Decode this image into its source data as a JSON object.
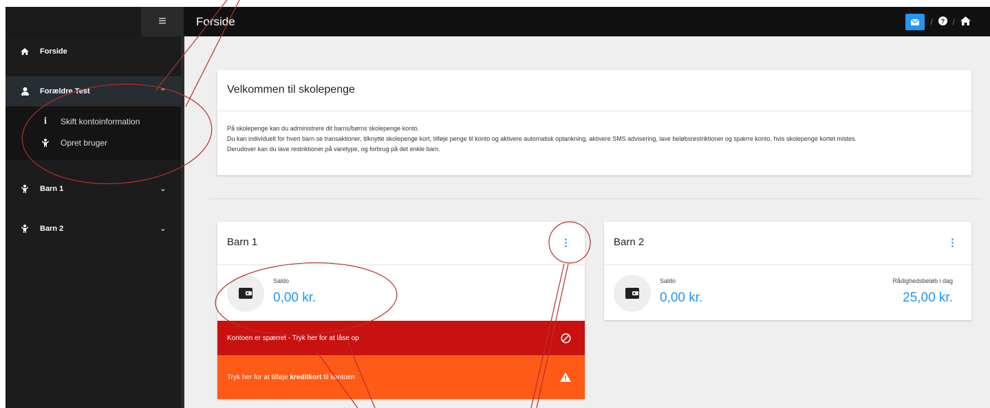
{
  "topbar": {
    "title": "Forside",
    "menu_icon": "hamburger-icon",
    "icons": [
      "envelope-icon",
      "question-circle-icon",
      "home-icon"
    ],
    "separator": "/"
  },
  "sidebar": {
    "items": [
      {
        "label": "Forside",
        "icon": "home-icon"
      },
      {
        "label": "Forældre Test",
        "icon": "user-icon"
      },
      {
        "label": "Barn 1",
        "icon": "child-icon"
      },
      {
        "label": "Barn 2",
        "icon": "child-icon"
      }
    ],
    "submenu": [
      {
        "label": "Skift kontoinformation",
        "icon": "info-icon"
      },
      {
        "label": "Opret bruger",
        "icon": "child-icon"
      }
    ]
  },
  "welcome": {
    "title": "Velkommen til skolepenge",
    "paragraphs": [
      "På skolepenge kan du administrere dit barns/børns skolepenge konto.",
      "Du kan individuelt for hvert barn se transaktioner, tilknytte skolepenge kort, tilføje penge til konto og aktivere automatisk optankning, aktivere SMS advisering, lave beløbsrestriktioner og spærre konto, hvis skolepenge kortet mistes.",
      "Derudover kan du lave restriktioner på varetype, og forbrug på det enkle barn."
    ]
  },
  "children": [
    {
      "name": "Barn 1",
      "saldo_label": "Saldo",
      "saldo_value": "0,00 kr.",
      "blocked_banner": "Kontoen er spærret - Tryk her for at låse op",
      "card_banner_prefix": "Tryk her for at tilføje ",
      "card_banner_bold": "kreditkort",
      "card_banner_suffix": " til kontoen"
    },
    {
      "name": "Barn 2",
      "saldo_label": "Saldo",
      "saldo_value": "0,00 kr.",
      "available_label": "Rådighedsbeløb i dag",
      "available_value": "25,00 kr."
    }
  ],
  "colors": {
    "accent": "#2196f3",
    "danger": "#c9120f",
    "warning": "#ff5a16",
    "annotation": "#b3312c"
  }
}
